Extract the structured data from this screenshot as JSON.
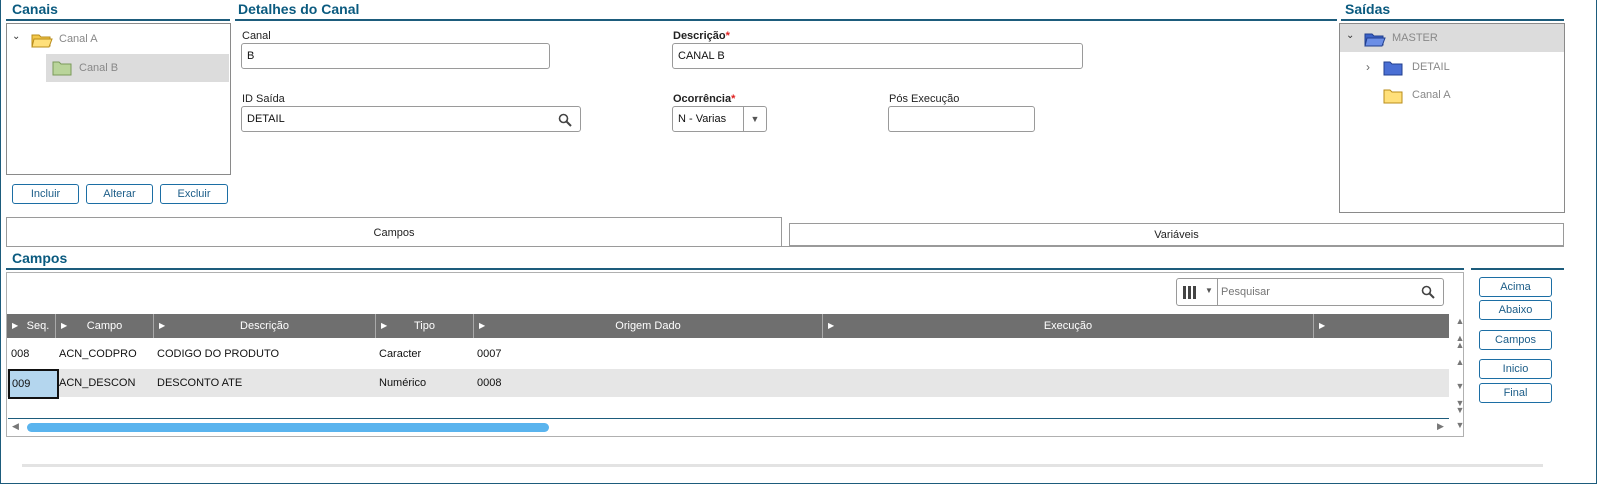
{
  "canais": {
    "title": "Canais",
    "tree": [
      {
        "label": "Canal A"
      },
      {
        "label": "Canal B"
      }
    ],
    "buttons": {
      "incluir": "Incluir",
      "alterar": "Alterar",
      "excluir": "Excluir"
    }
  },
  "detalhes": {
    "title": "Detalhes do Canal",
    "canal": {
      "label": "Canal",
      "value": "B"
    },
    "descricao": {
      "label": "Descrição",
      "required": "*",
      "value": "CANAL B"
    },
    "id_saida": {
      "label": "ID Saída",
      "value": "DETAIL"
    },
    "ocorrencia": {
      "label": "Ocorrência",
      "required": "*",
      "value": "N - Varias"
    },
    "pos_execucao": {
      "label": "Pós Execução",
      "value": ""
    }
  },
  "saidas": {
    "title": "Saídas",
    "tree": [
      {
        "label": "MASTER"
      },
      {
        "label": "DETAIL"
      },
      {
        "label": "Canal A"
      }
    ]
  },
  "tabs": [
    {
      "label": "Campos"
    },
    {
      "label": "Variáveis"
    }
  ],
  "campos": {
    "title": "Campos",
    "search_placeholder": "Pesquisar",
    "columns": [
      "Seq.",
      "Campo",
      "Descrição",
      "Tipo",
      "Origem Dado",
      "Execução"
    ],
    "rows": [
      [
        "008",
        "ACN_CODPRO",
        "CODIGO DO PRODUTO",
        "Caracter",
        "0007",
        ""
      ],
      [
        "009",
        "ACN_DESCON",
        "DESCONTO ATE",
        "Numérico",
        "0008",
        ""
      ]
    ],
    "side_buttons": {
      "acima": "Acima",
      "abaixo": "Abaixo",
      "campos": "Campos",
      "inicio": "Inicio",
      "final": "Final"
    }
  },
  "colors": {
    "accent": "#0a5a7f",
    "header_bg": "#6f6f6f",
    "selected_bg": "#dcdcdc",
    "scroll": "#5ab4ee"
  }
}
